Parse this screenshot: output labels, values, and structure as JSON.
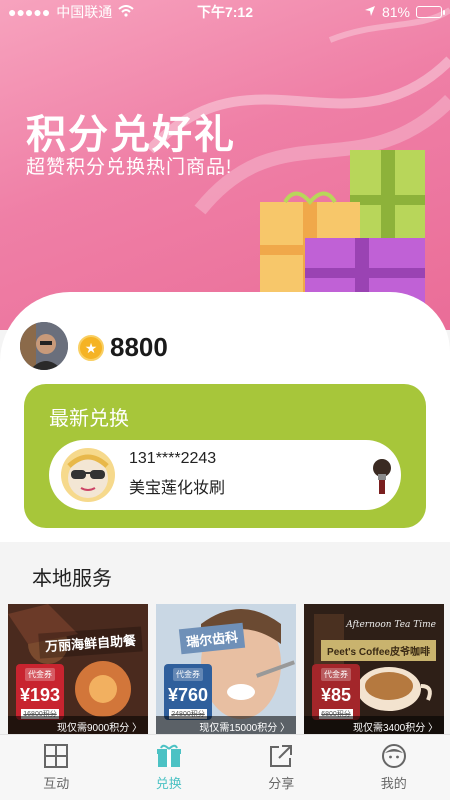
{
  "status_bar": {
    "carrier": "中国联通",
    "time": "下午7:12",
    "battery": "81%",
    "battery_level": 0.81
  },
  "hero": {
    "title": "积分兑好礼",
    "subtitle": "超赞积分兑换热门商品!"
  },
  "user": {
    "points": "8800"
  },
  "latest": {
    "title": "最新兑换",
    "phone": "131****2243",
    "prize": "美宝莲化妆刷"
  },
  "local": {
    "title": "本地服务",
    "tiles": [
      {
        "label": "万丽海鲜自助餐",
        "voucher_label": "代金券",
        "value": "¥193",
        "orig": "16800积分",
        "price": "现仅需9000积分 〉"
      },
      {
        "label": "瑞尔齿科",
        "voucher_label": "代金券",
        "value": "¥760",
        "orig": "24800积分",
        "price": "现仅需15000积分 〉"
      },
      {
        "script": "Afternoon Tea Time",
        "label": "Peet's Coffee皮爷咖啡",
        "voucher_label": "代金券",
        "value": "¥85",
        "orig": "6800积分",
        "price": "现仅需3400积分 〉"
      }
    ]
  },
  "tabs": [
    {
      "label": "互动",
      "icon": "grid-icon",
      "active": false
    },
    {
      "label": "兑换",
      "icon": "gift-icon",
      "active": true
    },
    {
      "label": "分享",
      "icon": "share-icon",
      "active": false
    },
    {
      "label": "我的",
      "icon": "profile-icon",
      "active": false
    }
  ],
  "colors": {
    "hero_pink": "#ef7fa6",
    "latest_green": "#a7c63a",
    "active_tab": "#4cc2c4"
  }
}
